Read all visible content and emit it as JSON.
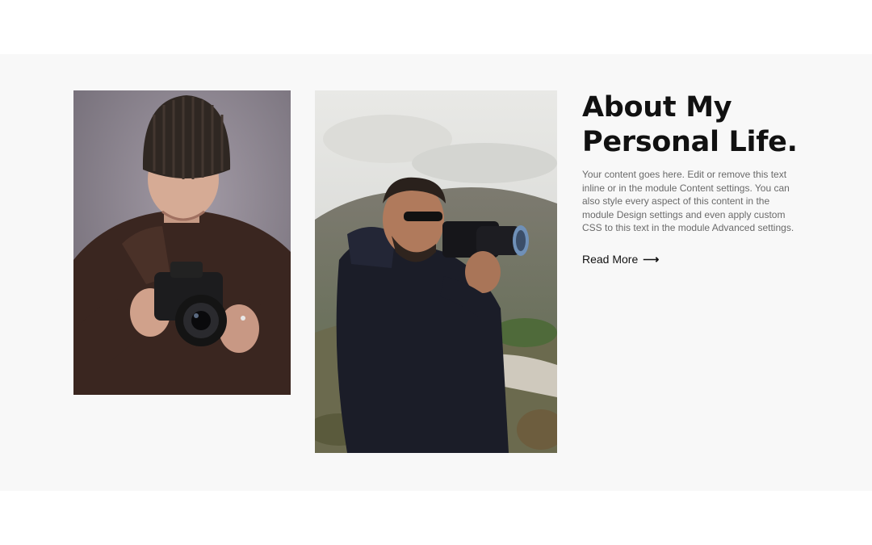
{
  "about": {
    "heading_line1": "About My",
    "heading_line2": "Personal Life.",
    "body": "Your content goes here. Edit or remove this text inline or in the module Content settings. You can also style every aspect of this content in the module Design settings and even apply custom CSS to this text in the module Advanced settings.",
    "read_more_label": "Read More",
    "read_more_icon": "arrow-right-icon"
  },
  "colors": {
    "section_bg": "#f8f8f8",
    "heading": "#111111",
    "body_text": "#6a6a6a"
  }
}
